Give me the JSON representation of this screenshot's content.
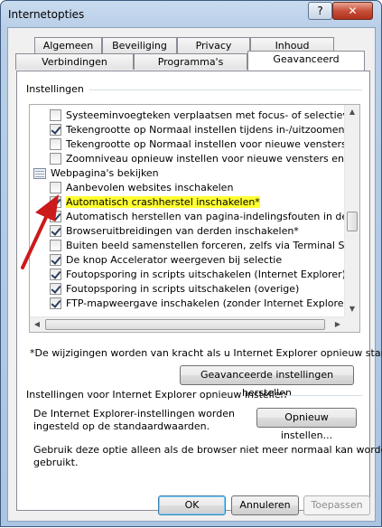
{
  "window": {
    "title": "Internetopties",
    "help_label": "?",
    "close_label": "✕"
  },
  "tabs": {
    "row1": [
      "Algemeen",
      "Beveiliging",
      "Privacy",
      "Inhoud"
    ],
    "row2": [
      "Verbindingen",
      "Programma's",
      "Geavanceerd"
    ],
    "active": "Geavanceerd"
  },
  "settings": {
    "group_label": "Instellingen",
    "items": [
      {
        "type": "checkbox",
        "checked": false,
        "label": "Systeeminvoegteken verplaatsen met focus- of selectieve"
      },
      {
        "type": "checkbox",
        "checked": true,
        "label": "Tekengrootte op Normaal instellen tijdens in-/uitzoomen*"
      },
      {
        "type": "checkbox",
        "checked": false,
        "label": "Tekengrootte op Normaal instellen voor nieuwe vensters e"
      },
      {
        "type": "checkbox",
        "checked": false,
        "label": "Zoomniveau opnieuw instellen voor nieuwe vensters en ta"
      },
      {
        "type": "category",
        "label": "Webpagina's bekijken"
      },
      {
        "type": "checkbox",
        "checked": false,
        "label": "Aanbevolen websites inschakelen"
      },
      {
        "type": "checkbox",
        "checked": true,
        "label": "Automatisch crashherstel inschakelen*",
        "highlighted": true
      },
      {
        "type": "checkbox",
        "checked": true,
        "label": "Automatisch herstellen van pagina-indelingsfouten in de c"
      },
      {
        "type": "checkbox",
        "checked": true,
        "label": "Browseruitbreidingen van derden inschakelen*"
      },
      {
        "type": "checkbox",
        "checked": false,
        "label": "Buiten beeld samenstellen forceren, zelfs via Terminal Serv"
      },
      {
        "type": "checkbox",
        "checked": true,
        "label": "De knop Accelerator weergeven bij selectie"
      },
      {
        "type": "checkbox",
        "checked": true,
        "label": "Foutopsporing in scripts uitschakelen (Internet Explorer)"
      },
      {
        "type": "checkbox",
        "checked": true,
        "label": "Foutopsporing in scripts uitschakelen (overige)"
      },
      {
        "type": "checkbox",
        "checked": true,
        "label": "FTP-mapweergave inschakelen (zonder Internet Explorer)"
      }
    ],
    "restart_note": "*De wijzigingen worden van kracht als u Internet Explorer opnieuw start.",
    "restore_button": "Geavanceerde instellingen herstellen"
  },
  "reset": {
    "group_label": "Instellingen voor Internet Explorer opnieuw instellen",
    "description_line1": "De Internet Explorer-instellingen worden",
    "description_line2": "ingesteld op de standaardwaarden.",
    "reset_button": "Opnieuw instellen...",
    "hint_line1": "Gebruik deze optie alleen als de browser niet meer normaal kan worden",
    "hint_line2": "gebruikt."
  },
  "footer": {
    "ok": "OK",
    "cancel": "Annuleren",
    "apply": "Toepassen"
  },
  "colors": {
    "highlight": "#ffff33",
    "annotation_arrow": "#cc1a1a"
  },
  "icons": {
    "category": "folder-list-icon",
    "annotation": "red-arrow-icon"
  }
}
